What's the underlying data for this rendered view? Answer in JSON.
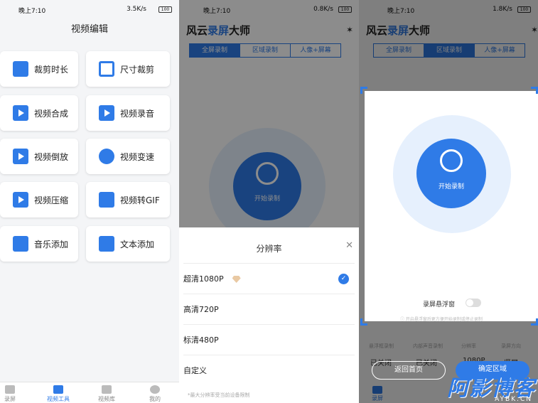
{
  "panel1": {
    "status": {
      "time": "晚上7:10",
      "speed": "3.5K/s",
      "battery": "100"
    },
    "title": "视频编辑",
    "tiles": [
      {
        "label": "裁剪时长",
        "icon": "trim-duration-icon"
      },
      {
        "label": "尺寸裁剪",
        "icon": "crop-size-icon"
      },
      {
        "label": "视频合成",
        "icon": "video-merge-icon"
      },
      {
        "label": "视频录音",
        "icon": "video-voiceover-icon"
      },
      {
        "label": "视频倒放",
        "icon": "video-reverse-icon"
      },
      {
        "label": "视频变速",
        "icon": "video-speed-icon"
      },
      {
        "label": "视频压缩",
        "icon": "video-compress-icon"
      },
      {
        "label": "视频转GIF",
        "icon": "video-to-gif-icon"
      },
      {
        "label": "音乐添加",
        "icon": "add-music-icon"
      },
      {
        "label": "文本添加",
        "icon": "add-text-icon"
      }
    ],
    "nav": [
      "录屏",
      "视频工具",
      "视频库",
      "我的"
    ]
  },
  "panel2": {
    "status": {
      "time": "晚上7:10",
      "speed": "0.8K/s",
      "battery": "100"
    },
    "app_title_a": "风云",
    "app_title_b": "录屏",
    "app_title_c": "大师",
    "tabs": [
      "全屏录制",
      "区域录制",
      "人像+屏幕"
    ],
    "record_label": "开始录制",
    "sheet": {
      "title": "分辨率",
      "options": [
        "超清1080P",
        "高清720P",
        "标清480P",
        "自定义"
      ],
      "note": "*最大分辨率受当前设备限制"
    }
  },
  "panel3": {
    "status": {
      "time": "晚上7:10",
      "speed": "1.8K/s",
      "battery": "100"
    },
    "app_title_a": "风云",
    "app_title_b": "录屏",
    "app_title_c": "大师",
    "tabs": [
      "全屏录制",
      "区域录制",
      "人像+屏幕"
    ],
    "record_label": "开始录制",
    "float_label": "录屏悬浮窗",
    "float_hint": "开启悬浮窗后更方便开始录制或停止录制",
    "bg_labels": [
      "悬浮框录制",
      "内部声音录制",
      "分辨率",
      "录屏方向"
    ],
    "bg_values": [
      "已关闭",
      "已关闭",
      "1080P",
      "竖屏"
    ],
    "back_button": "返回首页",
    "confirm_button": "确定区域",
    "nav_label": "录屏",
    "watermark": "阿影博客",
    "watermark_sub": "AYBK.CN"
  },
  "colors": {
    "accent": "#2f7be7",
    "ring_light": "#e6f0fd"
  }
}
